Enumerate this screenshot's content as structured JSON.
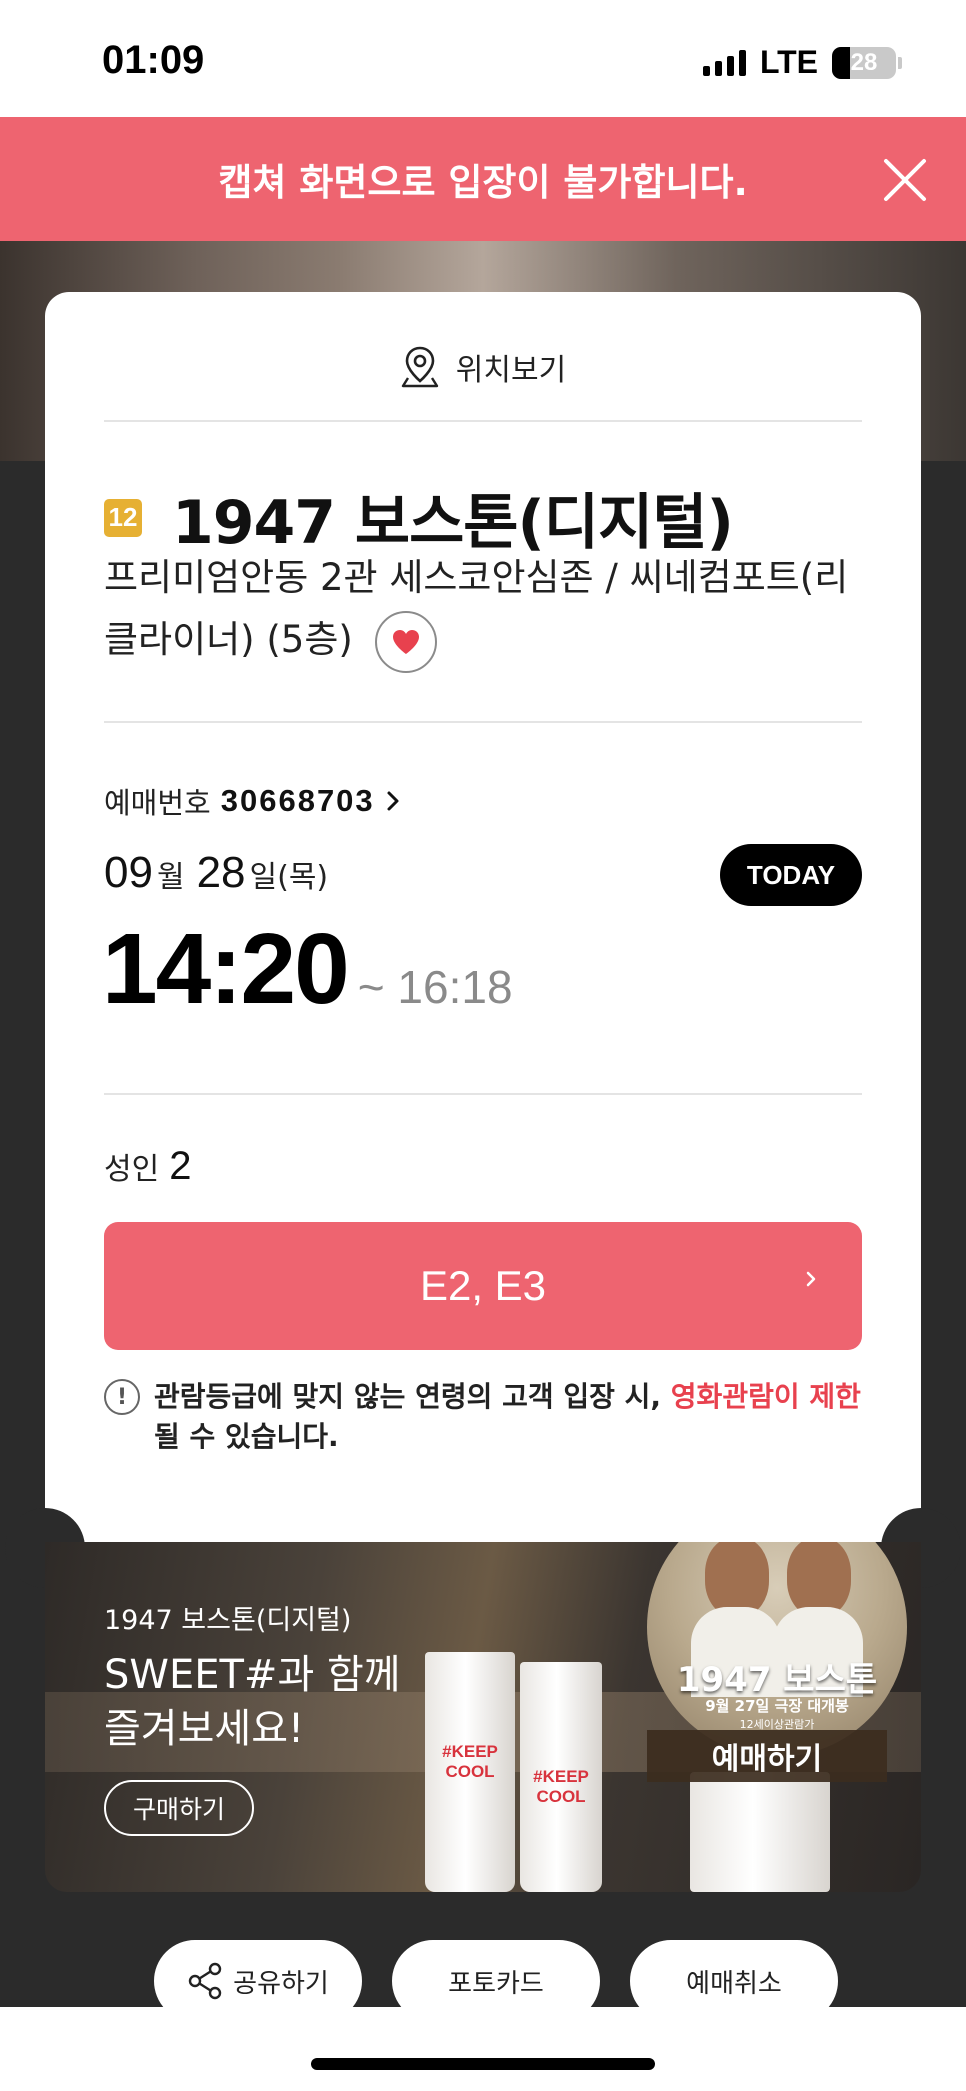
{
  "status_bar": {
    "time": "01:09",
    "network": "LTE",
    "battery_level": "28",
    "battery_fraction": 0.28
  },
  "notice": {
    "text": "캡쳐 화면으로 입장이 불가합니다.",
    "close_icon": "close-icon",
    "color": "#ee6470"
  },
  "ticket": {
    "location_label": "위치보기",
    "rating": "12",
    "rating_color": "#e6b033",
    "movie_title": "1947 보스톤(디지털)",
    "theater": "프리미엄안동 2관 세스코안심존 / 씨네컴포트(리클라이너)  (5층)",
    "booking_label": "예매번호",
    "booking_number": "30668703",
    "date": {
      "month": "09",
      "month_unit": "월",
      "day": "28",
      "day_unit": "일(목)"
    },
    "today_badge": "TODAY",
    "start_time": "14:20",
    "end_time": "~ 16:18",
    "people_label": "성인",
    "people_count": "2",
    "seats": "E2, E3",
    "warning_text": "관람등급에 맞지 않는 연령의 고객 입장 시, ",
    "warning_highlight": "영화관람이 제한",
    "warning_tail": "될 수 있습니다.",
    "accent_color": "#ee6470"
  },
  "ad": {
    "movie": "1947 보스톤(디지털)",
    "headline_line1": "SWEET#과 함께",
    "headline_line2": "즐겨보세요!",
    "buy_label": "구매하기",
    "cup_text_line1": "#KEEP",
    "cup_text_line2": "COOL",
    "poster_title": "1947 보스톤",
    "poster_subtitle": "9월 27일 극장 대개봉",
    "poster_rating_note": "12세이상관람가",
    "poster_book_label": "예매하기"
  },
  "actions": [
    {
      "label": "공유하기",
      "icon": "share-icon"
    },
    {
      "label": "포토카드",
      "icon": ""
    },
    {
      "label": "예매취소",
      "icon": ""
    }
  ]
}
